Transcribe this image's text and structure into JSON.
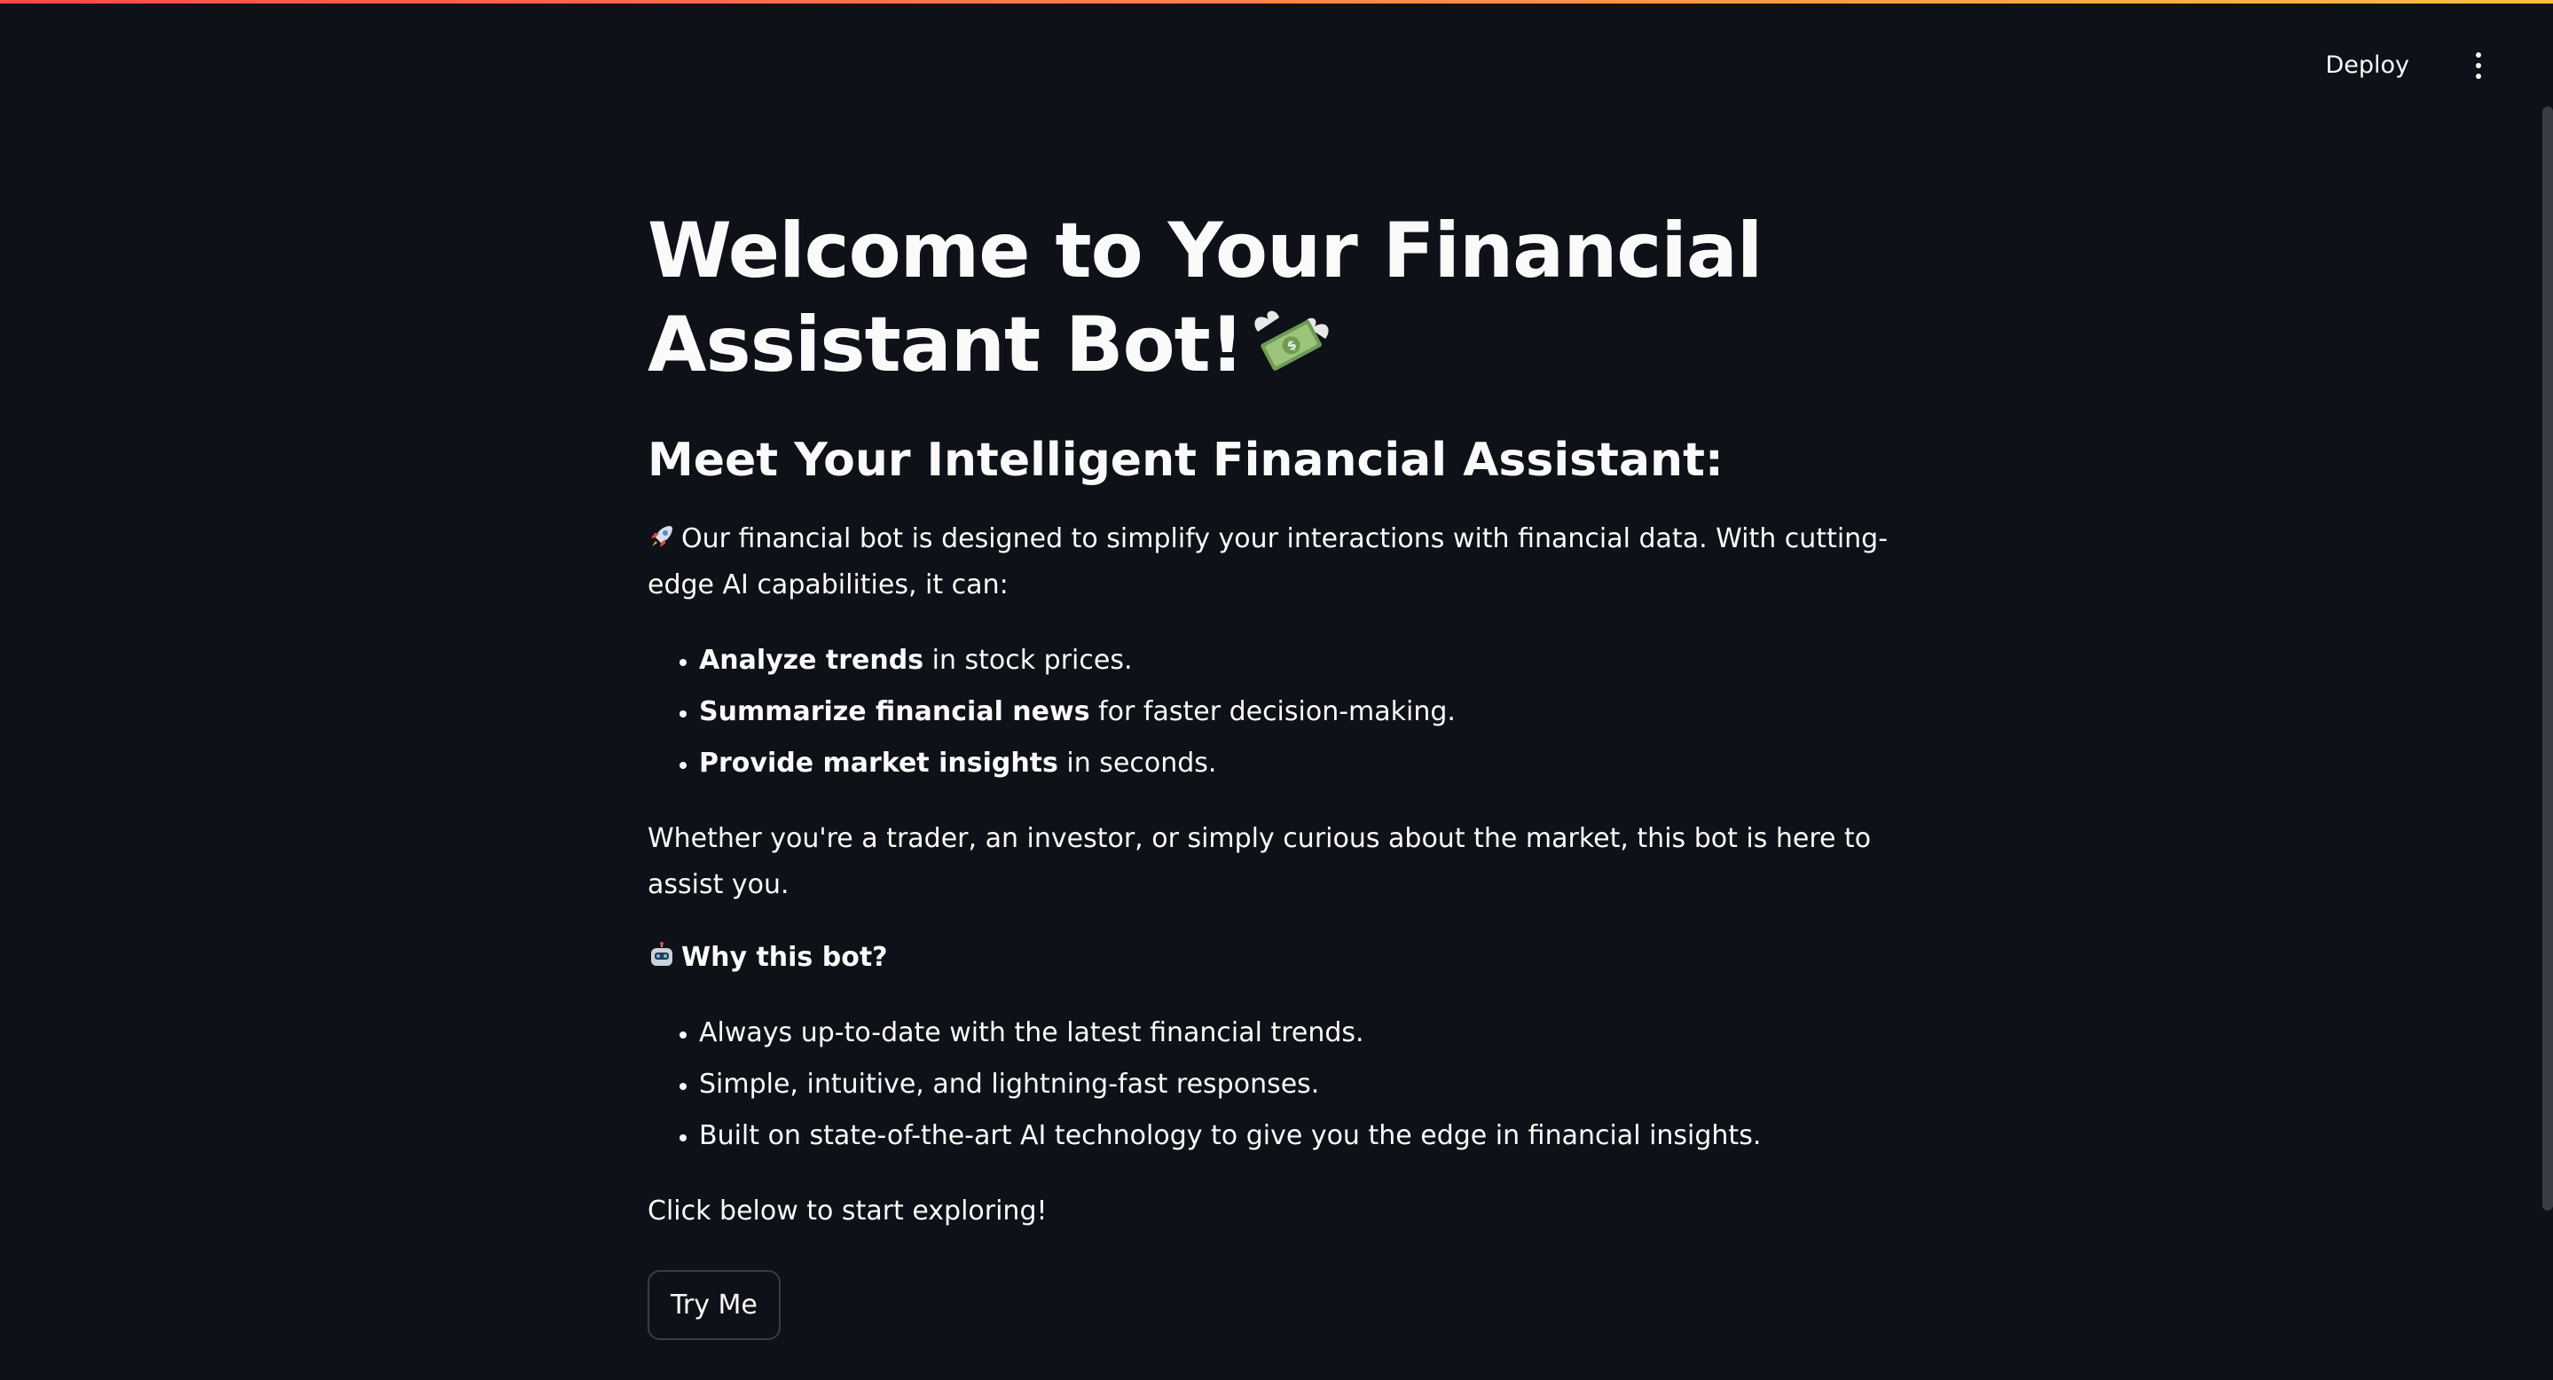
{
  "header": {
    "deploy_label": "Deploy",
    "menu_icon": "vertical-dots-icon",
    "accent_gradient": [
      "#ff4b4b",
      "#ffbd45"
    ]
  },
  "main": {
    "title": "Welcome to Your Financial Assistant Bot!",
    "title_icon": "money-with-wings-icon",
    "subheading": "Meet Your Intelligent Financial Assistant:",
    "intro_icon": "rocket-icon",
    "intro": "Our financial bot is designed to simplify your interactions with financial data. With cutting-edge AI capabilities, it can:",
    "capabilities": [
      {
        "bold": "Analyze trends",
        "rest": " in stock prices."
      },
      {
        "bold": "Summarize financial news",
        "rest": " for faster decision-making."
      },
      {
        "bold": "Provide market insights",
        "rest": " in seconds."
      }
    ],
    "audience": "Whether you're a trader, an investor, or simply curious about the market, this bot is here to assist you.",
    "why_icon": "robot-icon",
    "why_label": "Why this bot?",
    "reasons": [
      "Always up-to-date with the latest financial trends.",
      "Simple, intuitive, and lightning-fast responses.",
      "Built on state-of-the-art AI technology to give you the edge in financial insights."
    ],
    "cta_text": "Click below to start exploring!",
    "try_button_label": "Try Me"
  },
  "colors": {
    "background": "#0e1117",
    "text": "#fafafa",
    "button_border": "#3a3d45"
  }
}
